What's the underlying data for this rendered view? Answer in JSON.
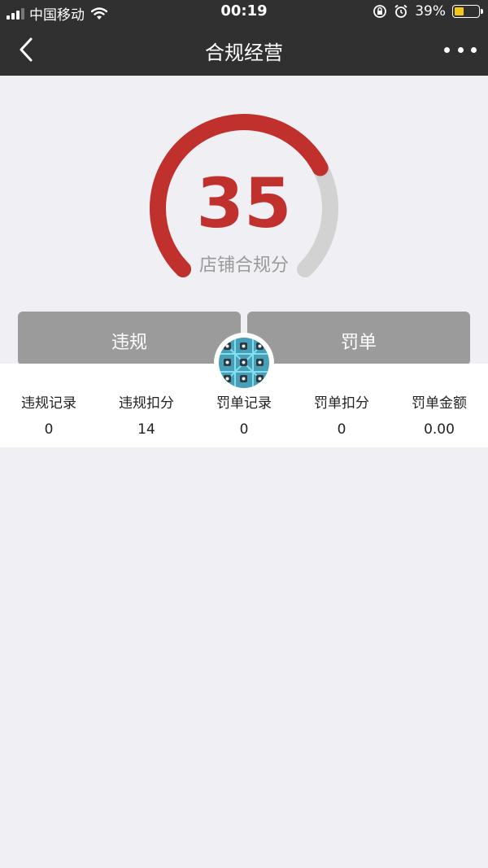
{
  "status": {
    "carrier": "中国移动",
    "time": "00:19",
    "battery": "39%",
    "battery_level": 0.39,
    "icons": [
      "signal-icon",
      "wifi-icon",
      "rotation-lock-icon",
      "alarm-icon",
      "battery-icon"
    ]
  },
  "nav": {
    "title": "合规经营",
    "back_icon": "chevron-left-icon",
    "more_icon": "more-dots-icon"
  },
  "score": {
    "value": "35",
    "label": "店铺合规分",
    "max": 100,
    "accent": "#c0302c",
    "track": "#d2d2d2"
  },
  "tabs": [
    {
      "label": "违规"
    },
    {
      "label": "罚单"
    }
  ],
  "stats": [
    {
      "label": "违规记录",
      "value": "0"
    },
    {
      "label": "违规扣分",
      "value": "14"
    },
    {
      "label": "罚单记录",
      "value": "0"
    },
    {
      "label": "罚单扣分",
      "value": "0"
    },
    {
      "label": "罚单金额",
      "value": "0.00"
    }
  ]
}
